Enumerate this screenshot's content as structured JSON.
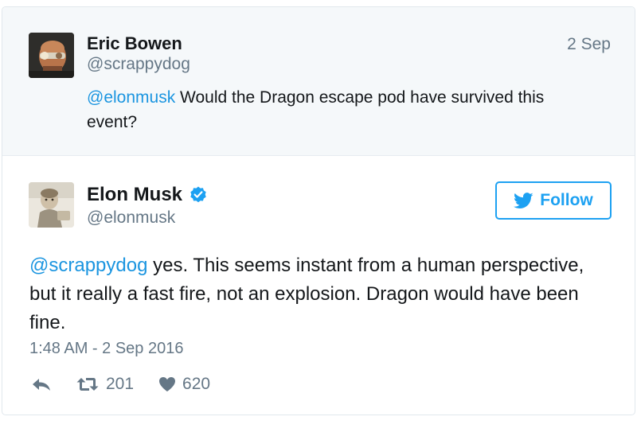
{
  "parent_tweet": {
    "author_name": "Eric Bowen",
    "author_handle": "@scrappydog",
    "date": "2 Sep",
    "mention": "@elonmusk",
    "text": " Would the Dragon escape pod have survived this event?"
  },
  "reply_tweet": {
    "author_name": "Elon Musk",
    "author_handle": "@elonmusk",
    "verified_icon": "verified-badge-icon",
    "follow_label": "Follow",
    "mention": "@scrappydog",
    "text": " yes. This seems instant from a human perspective, but it really a fast fire, not an explosion. Dragon would have been fine.",
    "timestamp": "1:48 AM - 2 Sep 2016",
    "retweet_count": "201",
    "like_count": "620"
  },
  "icons": {
    "reply": "reply-icon",
    "retweet": "retweet-icon",
    "like": "heart-icon",
    "follow": "twitter-bird-icon"
  },
  "colors": {
    "link": "#1b95e0",
    "accent": "#1da1f2",
    "muted": "#657786",
    "parent_background": "#f5f8fa"
  }
}
